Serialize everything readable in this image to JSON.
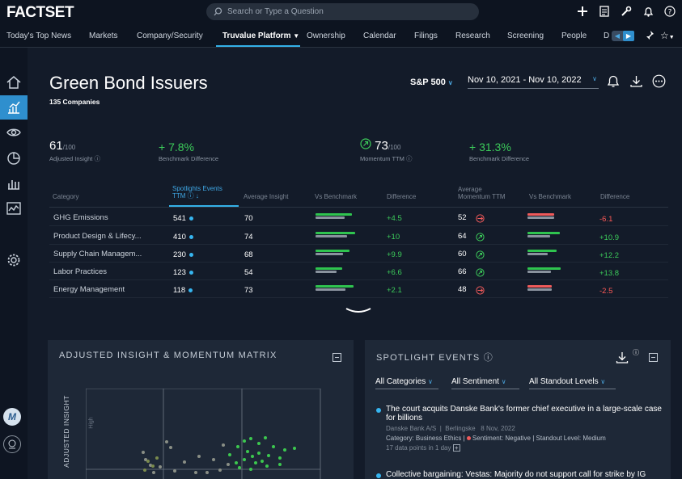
{
  "brand": {
    "logo": "FACTSET"
  },
  "search": {
    "placeholder": "Search or Type a Question"
  },
  "nav": {
    "items": [
      "Today's Top News",
      "Markets",
      "Company/Security",
      "Truvalue Platform",
      "Ownership",
      "Calendar",
      "Filings",
      "Research",
      "Screening",
      "People",
      "D"
    ]
  },
  "page": {
    "title": "Green Bond Issuers",
    "subtitle": "135 Companies",
    "index": "S&P 500",
    "date_range": "Nov 10, 2021 - Nov 10, 2022"
  },
  "kpis": {
    "insight_value": "61",
    "insight_scale": "/100",
    "insight_label": "Adjusted Insight",
    "insight_diff": "+ 7.8%",
    "insight_diff_label": "Benchmark Difference",
    "momentum_value": "73",
    "momentum_scale": "/100",
    "momentum_label": "Momentum TTM",
    "momentum_diff": "+ 31.3%",
    "momentum_diff_label": "Benchmark Difference"
  },
  "table": {
    "headers": {
      "category": "Category",
      "spotlights_1": "Spotlights Events",
      "spotlights_2": "TTM",
      "avg_insight": "Average Insight",
      "vs_bench_1": "Vs Benchmark",
      "diff_1": "Difference",
      "avg_mom_1": "Average",
      "avg_mom_2": "Momentum TTM",
      "vs_bench_2": "Vs Benchmark",
      "diff_2": "Difference"
    },
    "rows": [
      {
        "category": "GHG Emissions",
        "events": "541",
        "insight": "70",
        "insight_diff": "+4.5",
        "momentum": "52",
        "momentum_diff": "-6.1",
        "insight_bar": 0.75,
        "mom_bar": 0.55
      },
      {
        "category": "Product Design & Lifecy...",
        "events": "410",
        "insight": "74",
        "insight_diff": "+10",
        "momentum": "64",
        "momentum_diff": "+10.9",
        "insight_bar": 0.82,
        "mom_bar": 0.66
      },
      {
        "category": "Supply Chain Managem...",
        "events": "230",
        "insight": "68",
        "insight_diff": "+9.9",
        "momentum": "60",
        "momentum_diff": "+12.2",
        "insight_bar": 0.7,
        "mom_bar": 0.6
      },
      {
        "category": "Labor Practices",
        "events": "123",
        "insight": "54",
        "insight_diff": "+6.6",
        "momentum": "66",
        "momentum_diff": "+13.8",
        "insight_bar": 0.55,
        "mom_bar": 0.68
      },
      {
        "category": "Energy Management",
        "events": "118",
        "insight": "73",
        "insight_diff": "+2.1",
        "momentum": "48",
        "momentum_diff": "-2.5",
        "insight_bar": 0.78,
        "mom_bar": 0.5
      }
    ]
  },
  "matrix": {
    "title": "ADJUSTED INSIGHT & MOMENTUM MATRIX",
    "y_axis": "ADJUSTED INSIGHT",
    "y_hint": "High"
  },
  "spotlight": {
    "title": "SPOTLIGHT EVENTS",
    "filters": [
      "All Categories",
      "All Sentiment",
      "All Standout Levels"
    ],
    "events": [
      {
        "headline_1": "The court acquits Danske Bank's former chief executive in a large-scale case",
        "headline_2": "for billions",
        "company": "Danske Bank A/S",
        "source": "Berlingske",
        "date": "8 Nov, 2022",
        "category": "Category: Business Ethics",
        "sentiment": "Sentiment: Negative",
        "standout": "Standout Level: Medium",
        "datapoints": "17 data points in 1 day"
      },
      {
        "headline_1": "Collective bargaining: Vestas: Majority do not support call for strike by IG"
      }
    ]
  },
  "colors": {
    "accent": "#34b1e8",
    "positive": "#3ccc5a",
    "negative": "#f05a5a",
    "background": "#131b29"
  }
}
